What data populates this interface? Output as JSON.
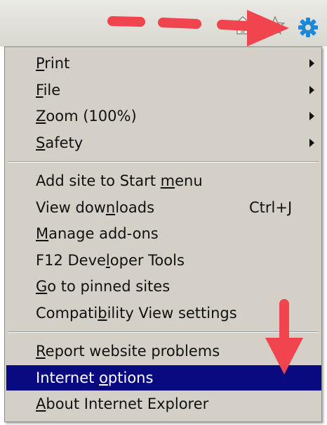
{
  "menu": {
    "groups": [
      [
        {
          "pre": "",
          "key": "P",
          "post": "rint",
          "submenu": true
        },
        {
          "pre": "",
          "key": "F",
          "post": "ile",
          "submenu": true
        },
        {
          "pre": "",
          "key": "Z",
          "post": "oom (100%)",
          "submenu": true
        },
        {
          "pre": "",
          "key": "S",
          "post": "afety",
          "submenu": true
        }
      ],
      [
        {
          "pre": "Add site to Start ",
          "key": "m",
          "post": "enu"
        },
        {
          "pre": "View dow",
          "key": "n",
          "post": "loads",
          "shortcut": "Ctrl+J"
        },
        {
          "pre": "",
          "key": "M",
          "post": "anage add-ons"
        },
        {
          "pre": "F12 Deve",
          "key": "l",
          "post": "oper Tools"
        },
        {
          "pre": "",
          "key": "G",
          "post": "o to pinned sites"
        },
        {
          "pre": "Compati",
          "key": "b",
          "post": "ility View settings"
        }
      ],
      [
        {
          "pre": "",
          "key": "R",
          "post": "eport website problems"
        },
        {
          "pre": "Internet ",
          "key": "o",
          "post": "ptions",
          "selected": true
        },
        {
          "pre": "",
          "key": "A",
          "post": "bout Internet Explorer"
        }
      ]
    ]
  },
  "toolbar": {
    "icons": [
      "home-icon",
      "favorites-star-icon",
      "gear-icon"
    ]
  },
  "colors": {
    "menu_bg": "#d4d0c8",
    "selected_bg": "#0a0a80",
    "gear_blue": "#1e88d6",
    "annotation_arrow": "#f0454f"
  }
}
